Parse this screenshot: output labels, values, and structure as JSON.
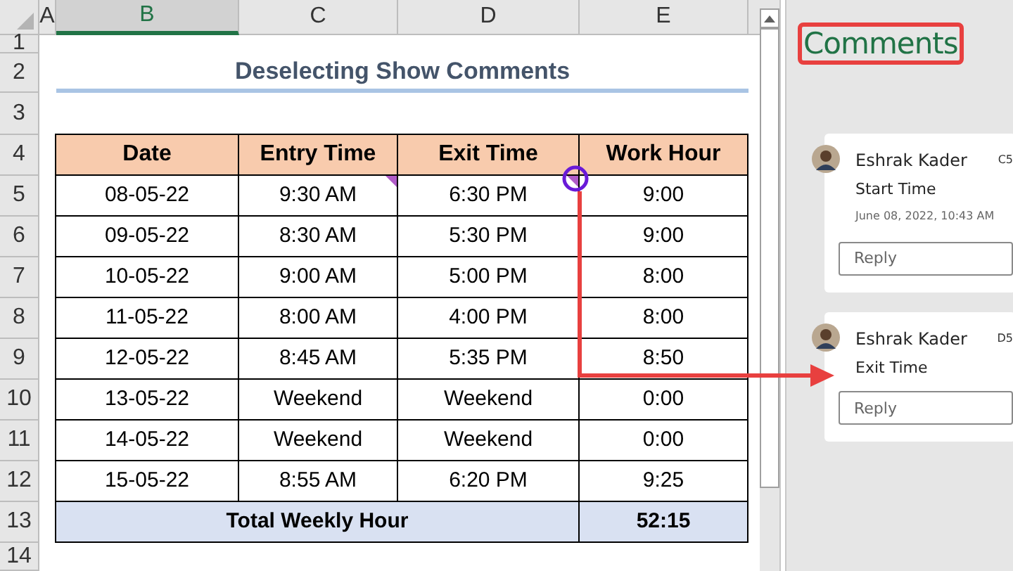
{
  "column_headers": [
    {
      "label": "A",
      "selected": false
    },
    {
      "label": "B",
      "selected": true
    },
    {
      "label": "C",
      "selected": false
    },
    {
      "label": "D",
      "selected": false
    },
    {
      "label": "E",
      "selected": false
    }
  ],
  "row_headers": [
    "1",
    "2",
    "3",
    "4",
    "5",
    "6",
    "7",
    "8",
    "9",
    "10",
    "11",
    "12",
    "13",
    "14"
  ],
  "title": "Deselecting Show Comments",
  "table": {
    "columns": [
      "Date",
      "Entry Time",
      "Exit Time",
      "Work Hour"
    ],
    "rows": [
      {
        "cells": [
          {
            "text": "08-05-22",
            "has_comment": false
          },
          {
            "text": "9:30 AM",
            "has_comment": true
          },
          {
            "text": "6:30 PM",
            "has_comment": true
          },
          {
            "text": "9:00",
            "has_comment": false
          }
        ]
      },
      {
        "cells": [
          {
            "text": "09-05-22",
            "has_comment": false
          },
          {
            "text": "8:30 AM",
            "has_comment": false
          },
          {
            "text": "5:30 PM",
            "has_comment": false
          },
          {
            "text": "9:00",
            "has_comment": false
          }
        ]
      },
      {
        "cells": [
          {
            "text": "10-05-22",
            "has_comment": false
          },
          {
            "text": "9:00 AM",
            "has_comment": false
          },
          {
            "text": "5:00 PM",
            "has_comment": false
          },
          {
            "text": "8:00",
            "has_comment": false
          }
        ]
      },
      {
        "cells": [
          {
            "text": "11-05-22",
            "has_comment": false
          },
          {
            "text": "8:00 AM",
            "has_comment": false
          },
          {
            "text": "4:00 PM",
            "has_comment": false
          },
          {
            "text": "8:00",
            "has_comment": false
          }
        ]
      },
      {
        "cells": [
          {
            "text": "12-05-22",
            "has_comment": false
          },
          {
            "text": "8:45 AM",
            "has_comment": false
          },
          {
            "text": "5:35 PM",
            "has_comment": false
          },
          {
            "text": "8:50",
            "has_comment": false
          }
        ]
      },
      {
        "cells": [
          {
            "text": "13-05-22",
            "has_comment": false
          },
          {
            "text": "Weekend",
            "has_comment": false
          },
          {
            "text": "Weekend",
            "has_comment": false
          },
          {
            "text": "0:00",
            "has_comment": false
          }
        ]
      },
      {
        "cells": [
          {
            "text": "14-05-22",
            "has_comment": false
          },
          {
            "text": "Weekend",
            "has_comment": false
          },
          {
            "text": "Weekend",
            "has_comment": false
          },
          {
            "text": "0:00",
            "has_comment": false
          }
        ]
      },
      {
        "cells": [
          {
            "text": "15-05-22",
            "has_comment": false
          },
          {
            "text": "8:55 AM",
            "has_comment": false
          },
          {
            "text": "6:20 PM",
            "has_comment": false
          },
          {
            "text": "9:25",
            "has_comment": false
          }
        ]
      }
    ],
    "total": {
      "label": "Total Weekly Hour",
      "value": "52:15"
    }
  },
  "comments_pane": {
    "title": "Comments",
    "threads": [
      {
        "author": "Eshrak Kader",
        "cell": "C5",
        "text": "Start Time",
        "timestamp": "June 08, 2022, 10:43 AM",
        "reply_placeholder": "Reply"
      },
      {
        "author": "Eshrak Kader",
        "cell": "D5",
        "text": "Exit Time",
        "reply_placeholder": "Reply"
      }
    ]
  }
}
